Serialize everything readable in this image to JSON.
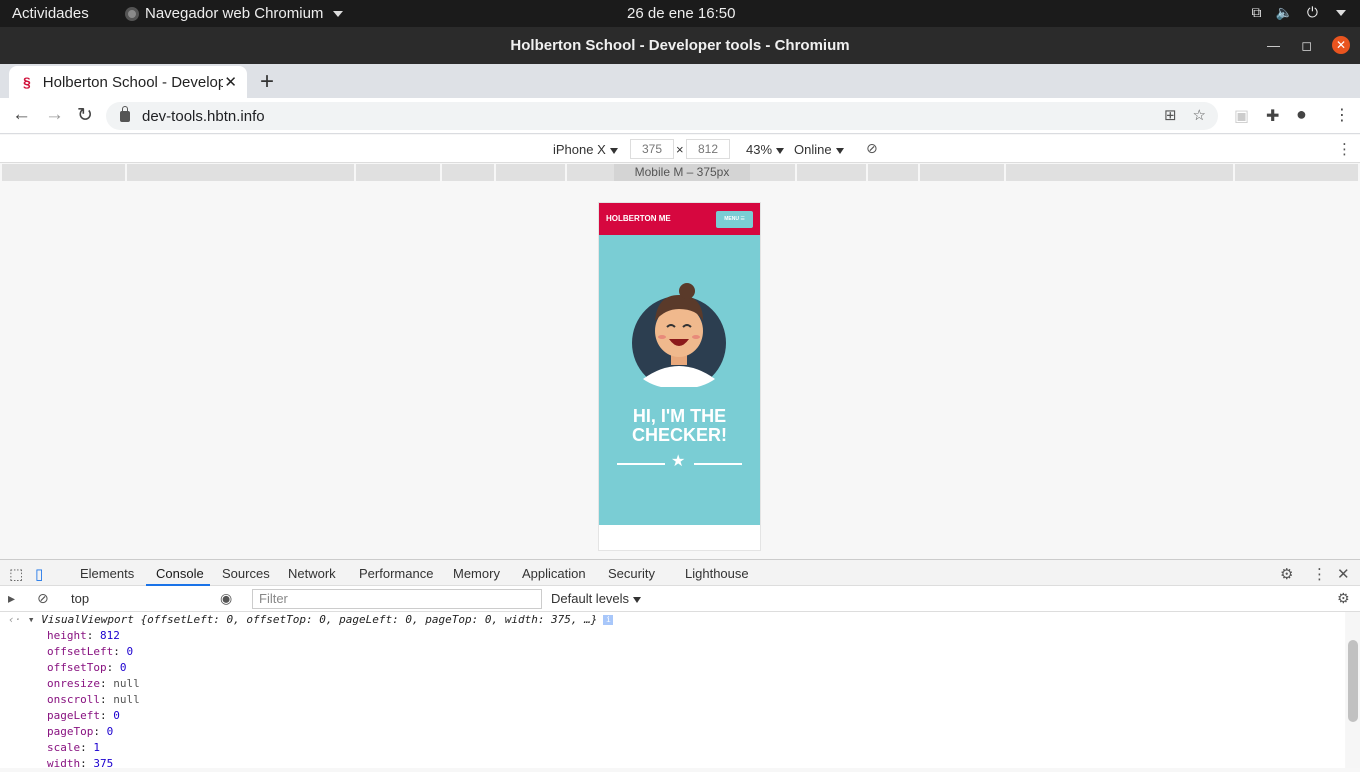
{
  "topbar": {
    "activities": "Actividades",
    "app": "Navegador web Chromium",
    "clock": "26 de ene  16:50"
  },
  "window": {
    "title": "Holberton School - Developer tools - Chromium"
  },
  "tab": {
    "title": "Holberton School - Developer tools"
  },
  "address": {
    "url": "dev-tools.hbtn.info"
  },
  "device_toolbar": {
    "device": "iPhone X",
    "width": "375",
    "times": "×",
    "height": "812",
    "zoom": "43%",
    "network": "Online",
    "media_query_label": "Mobile M – 375px"
  },
  "page": {
    "brand": "HOLBERTON ME",
    "menu": "MENU ☰",
    "headline_line1": "HI, I'M THE",
    "headline_line2": "CHECKER!",
    "colors": {
      "header": "#d6073f",
      "hero": "#7acdd4"
    }
  },
  "devtools": {
    "tabs": [
      "Elements",
      "Console",
      "Sources",
      "Network",
      "Performance",
      "Memory",
      "Application",
      "Security",
      "Lighthouse"
    ],
    "active_tab": "Console",
    "context": "top",
    "filter_placeholder": "Filter",
    "levels": "Default levels"
  },
  "console": {
    "summary": "VisualViewport {offsetLeft: 0, offsetTop: 0, pageLeft: 0, pageTop: 0, width: 375, …}",
    "props": [
      {
        "key": "height",
        "value": "812",
        "type": "number"
      },
      {
        "key": "offsetLeft",
        "value": "0",
        "type": "number"
      },
      {
        "key": "offsetTop",
        "value": "0",
        "type": "number"
      },
      {
        "key": "onresize",
        "value": "null",
        "type": "null"
      },
      {
        "key": "onscroll",
        "value": "null",
        "type": "null"
      },
      {
        "key": "pageLeft",
        "value": "0",
        "type": "number"
      },
      {
        "key": "pageTop",
        "value": "0",
        "type": "number"
      },
      {
        "key": "scale",
        "value": "1",
        "type": "number"
      },
      {
        "key": "width",
        "value": "375",
        "type": "number"
      }
    ]
  }
}
